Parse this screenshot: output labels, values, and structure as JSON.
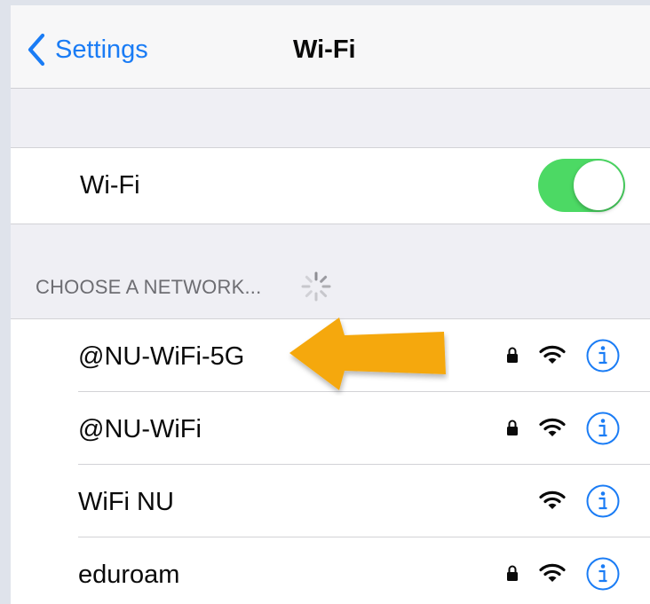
{
  "navigation": {
    "back_label": "Settings",
    "title": "Wi-Fi"
  },
  "wifi_toggle": {
    "label": "Wi-Fi",
    "state": "on",
    "color": "#4cd964"
  },
  "networks_section": {
    "header": "CHOOSE A NETWORK...",
    "spinner_icon": "activity-spinner-icon"
  },
  "networks": [
    {
      "name": "@NU-WiFi-5G",
      "secured": true
    },
    {
      "name": "@NU-WiFi",
      "secured": true
    },
    {
      "name": "WiFi NU",
      "secured": false
    },
    {
      "name": "eduroam",
      "secured": true
    }
  ],
  "annotation": {
    "arrow_color": "#f5a80d",
    "points_to": "@NU-WiFi-5G"
  },
  "colors": {
    "accent": "#1a7cf5",
    "grouped_background": "#efeff4"
  }
}
